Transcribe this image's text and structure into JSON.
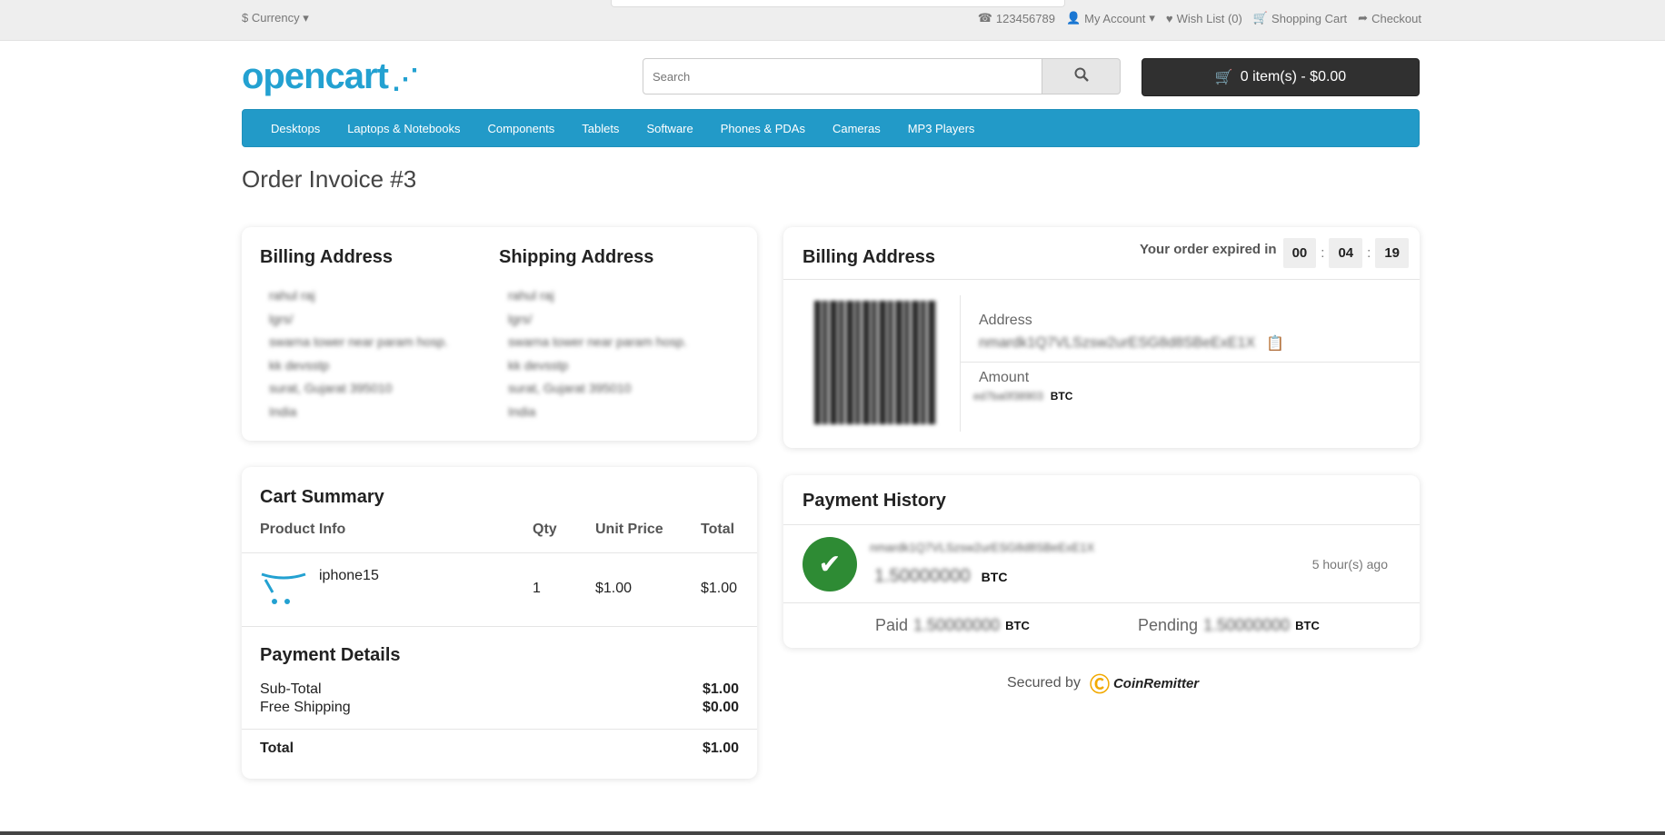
{
  "topbar": {
    "currency": "$ Currency",
    "phone": "123456789",
    "my_account": "My Account",
    "wish_list": "Wish List (0)",
    "shopping_cart": "Shopping Cart",
    "checkout": "Checkout"
  },
  "header": {
    "logo_text": "opencart",
    "search_placeholder": "Search",
    "cart_label": "0 item(s) - $0.00"
  },
  "nav": [
    "Desktops",
    "Laptops & Notebooks",
    "Components",
    "Tablets",
    "Software",
    "Phones & PDAs",
    "Cameras",
    "MP3 Players"
  ],
  "page_title": "Order Invoice #3",
  "billing_address_card": {
    "billing_title": "Billing Address",
    "shipping_title": "Shipping Address",
    "billing_lines": [
      "rahul raj",
      "lgrs/",
      "swarna tower near param hosp.",
      "kk devsstp",
      "surat, Gujarat 395010",
      "India"
    ],
    "shipping_lines": [
      "rahul raj",
      "lgrs/",
      "swarna tower near param hosp.",
      "kk devsstp",
      "surat, Gujarat 395010",
      "India"
    ]
  },
  "payment_card": {
    "title": "Billing Address",
    "timer_label": "Your order expired in",
    "timer": {
      "hours": "00",
      "minutes": "04",
      "seconds": "19"
    },
    "address_label": "Address",
    "address_value": "nmardk1Q7VLSzsw2urESG8d8SBeExE1X",
    "amount_label": "Amount",
    "amount_value": "ed7ba0f38903",
    "amount_unit": "BTC"
  },
  "cart_summary": {
    "title": "Cart Summary",
    "headers": {
      "product": "Product Info",
      "qty": "Qty",
      "unit_price": "Unit Price",
      "total": "Total"
    },
    "rows": [
      {
        "product": "iphone15",
        "qty": "1",
        "unit_price": "$1.00",
        "total": "$1.00"
      }
    ]
  },
  "payment_details": {
    "title": "Payment Details",
    "subtotal_label": "Sub-Total",
    "subtotal_value": "$1.00",
    "shipping_label": "Free Shipping",
    "shipping_value": "$0.00",
    "total_label": "Total",
    "total_value": "$1.00"
  },
  "payment_history": {
    "title": "Payment History",
    "entry": {
      "txid": "nmardk1Q7VLSzsw2urESG8d8SBeExE1X",
      "amount": "1.50000000",
      "unit": "BTC",
      "time_ago": "5 hour(s) ago"
    },
    "paid_label": "Paid",
    "paid_value": "1.50000000",
    "paid_unit": "BTC",
    "pending_label": "Pending",
    "pending_value": "1.50000000",
    "pending_unit": "BTC"
  },
  "secured": {
    "label": "Secured by",
    "brand": "CoinRemitter"
  },
  "colors": {
    "nav_blue": "#229ac8",
    "logo_blue": "#23a1d1",
    "success_green": "#2e8b34",
    "cart_button": "#303030"
  }
}
